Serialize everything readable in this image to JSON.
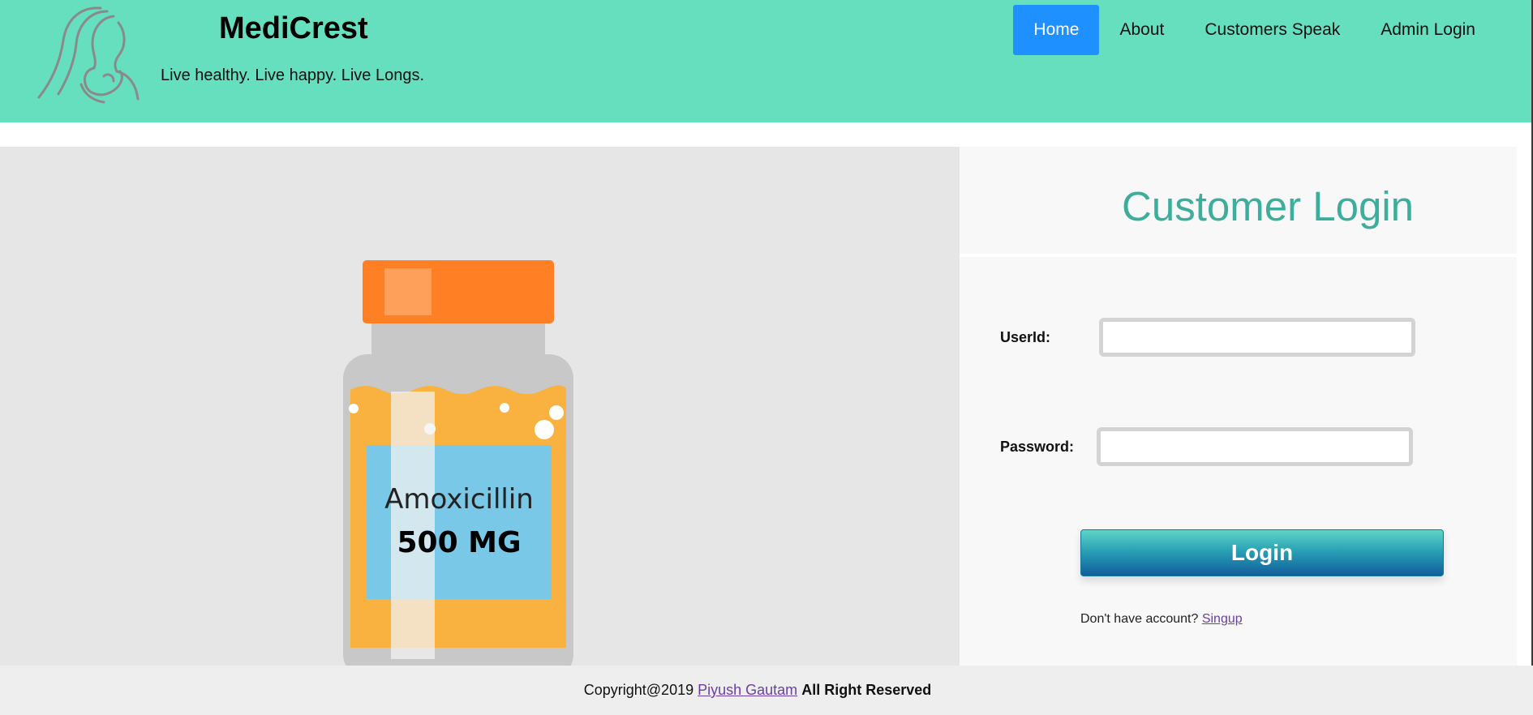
{
  "header": {
    "brand_title": "MediCrest",
    "tagline": "Live healthy. Live happy. Live Longs.",
    "logo_icon": "mother-child-logo-icon",
    "nav": [
      {
        "label": "Home",
        "active": true
      },
      {
        "label": "About",
        "active": false
      },
      {
        "label": "Customers Speak",
        "active": false
      },
      {
        "label": "Admin Login",
        "active": false
      }
    ],
    "colors": {
      "header_bg": "#66dfbf",
      "nav_active": "#1e90ff"
    }
  },
  "hero": {
    "bottle_label_name": "Amoxicillin",
    "bottle_label_dose": "500 MG",
    "colors": {
      "cap": "#ff8024",
      "body": "#f9b13f",
      "label": "#79c8e8",
      "glass": "#c8c8c8"
    }
  },
  "login": {
    "title": "Customer Login",
    "userid_label": "UserId:",
    "userid_value": "",
    "password_label": "Password:",
    "password_value": "",
    "button_label": "Login",
    "signup_prompt": "Don't have account?",
    "signup_link": "Singup",
    "colors": {
      "title": "#3dae9b"
    }
  },
  "footer": {
    "copyright": "Copyright@2019",
    "author_link": "Piyush Gautam",
    "rights": "All Right Reserved"
  }
}
